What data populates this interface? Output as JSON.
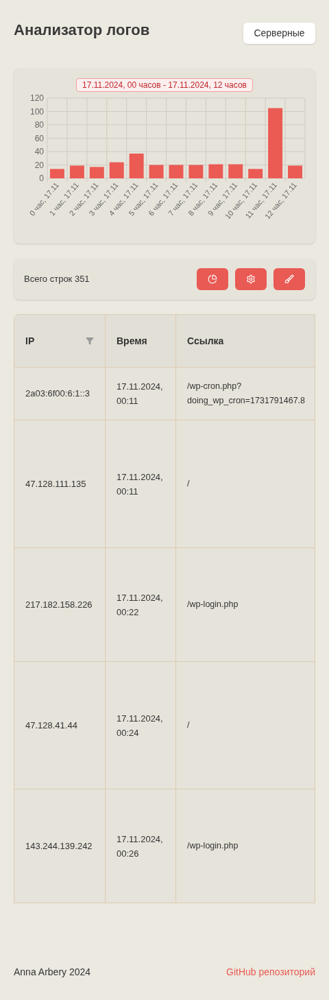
{
  "header": {
    "title": "Анализатор логов",
    "button": "Серверные"
  },
  "chart": {
    "chart_data": {
      "type": "bar",
      "grid": true,
      "categories": [
        "0 час, 17.11",
        "1 час, 17.11",
        "2 час, 17.11",
        "3 час, 17.11",
        "4 час, 17.11",
        "5 час, 17.11",
        "6 час, 17.11",
        "7 час, 17.11",
        "8 час, 17.11",
        "9 час, 17.11",
        "10 час, 17.11",
        "11 час, 17.11",
        "12 час, 17.11"
      ],
      "series": [
        {
          "name": "17.11.2024, 00 часов - 17.11.2024, 12 часов",
          "color": "#eb5a53",
          "values": [
            14,
            19,
            17,
            24,
            37,
            20,
            20,
            20,
            21,
            21,
            14,
            105,
            19
          ]
        }
      ],
      "ylim": [
        0,
        120
      ],
      "yticks": [
        0,
        20,
        40,
        60,
        80,
        100,
        120
      ]
    }
  },
  "toolbar": {
    "total": "Всего строк 351",
    "buttons": [
      {
        "kind": "pie"
      },
      {
        "kind": "settings"
      },
      {
        "kind": "clean"
      }
    ]
  },
  "table": {
    "columns": [
      {
        "label": "IP",
        "filter": true
      },
      {
        "label": "Время",
        "filter": false
      },
      {
        "label": "Ссылка",
        "filter": false
      }
    ],
    "rows": [
      {
        "ip": "2a03:6f00:6:1::3",
        "time": [
          "17.11.2024,",
          "00:11"
        ],
        "link": [
          "/wp-cron.php?",
          "doing_wp_cron=1731791467.8"
        ]
      },
      {
        "ip": "47.128.111.135",
        "time": [
          "17.11.2024,",
          "00:11"
        ],
        "link": [
          "/"
        ]
      },
      {
        "ip": "217.182.158.226",
        "time": [
          "17.11.2024,",
          "00:22"
        ],
        "link": [
          "/wp-login.php"
        ]
      },
      {
        "ip": "47.128.41.44",
        "time": [
          "17.11.2024,",
          "00:24"
        ],
        "link": [
          "/"
        ]
      },
      {
        "ip": "143.244.139.242",
        "time": [
          "17.11.2024,",
          "00:26"
        ],
        "link": [
          "/wp-login.php"
        ]
      }
    ]
  },
  "footer": {
    "author": "Anna Arbery 2024",
    "link": "GitHub репозиторий"
  }
}
